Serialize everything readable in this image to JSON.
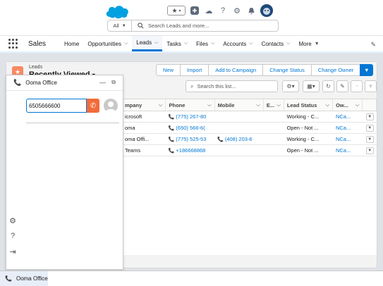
{
  "header": {
    "search_scope": "All",
    "search_placeholder": "Search Leads and more..."
  },
  "nav": {
    "app_name": "Sales",
    "items": [
      {
        "label": "Home",
        "has_menu": false,
        "active": false
      },
      {
        "label": "Opportunities",
        "has_menu": true,
        "active": false
      },
      {
        "label": "Leads",
        "has_menu": true,
        "active": true
      },
      {
        "label": "Tasks",
        "has_menu": true,
        "active": false
      },
      {
        "label": "Files",
        "has_menu": true,
        "active": false
      },
      {
        "label": "Accounts",
        "has_menu": true,
        "active": false
      },
      {
        "label": "Contacts",
        "has_menu": true,
        "active": false
      },
      {
        "label": "More",
        "has_menu": true,
        "active": false
      }
    ]
  },
  "list": {
    "object_label": "Leads",
    "view_name": "Recently Viewed",
    "actions": [
      "New",
      "Import",
      "Add to Campaign",
      "Change Status",
      "Change Owner"
    ],
    "search_placeholder": "Search this list..."
  },
  "table": {
    "columns": [
      "mpany",
      "Phone",
      "Mobile",
      "E...",
      "Lead Status",
      "Ow..."
    ],
    "rows": [
      {
        "company": "icrosoft",
        "phone": "(775) 267-80",
        "mobile": "",
        "status": "Working - C...",
        "owner": "NCa..."
      },
      {
        "company": "oma",
        "phone": "(650) 566-6(",
        "mobile": "",
        "status": "Open - Not ...",
        "owner": "NCa..."
      },
      {
        "company": "oma Offi...",
        "phone": "(775) 525-53",
        "mobile": "(408) 203-6",
        "status": "Working - C...",
        "owner": "NCa..."
      },
      {
        "company": "Teams",
        "phone": "+186668868",
        "mobile": "",
        "status": "Open - Not ...",
        "owner": "NCa..."
      }
    ]
  },
  "softphone": {
    "title": "Ooma Office",
    "dial_value": "6505666600"
  },
  "utility_bar": {
    "tab_label": "Ooma Office"
  },
  "colors": {
    "brand_blue": "#0176d3",
    "call_orange": "#f26b3a",
    "lead_icon": "#f88962"
  }
}
